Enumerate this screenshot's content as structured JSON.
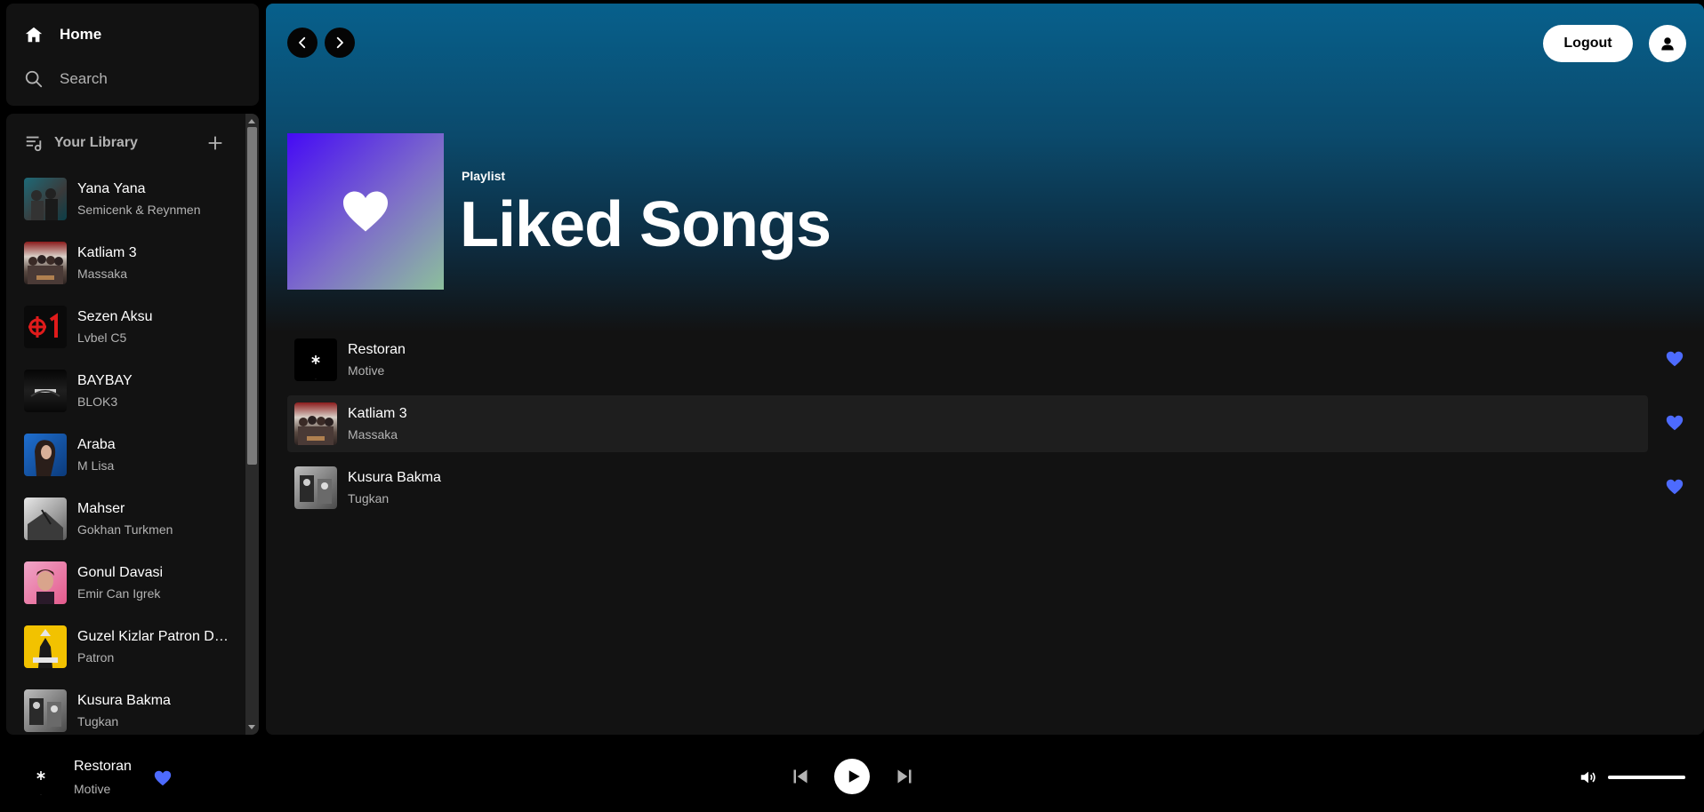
{
  "nav": {
    "home_label": "Home",
    "search_label": "Search"
  },
  "library": {
    "title": "Your Library",
    "items": [
      {
        "title": "Yana Yana",
        "subtitle": "Semicenk & Reynmen",
        "cover": "teal-group-photo"
      },
      {
        "title": "Katliam 3",
        "subtitle": "Massaka",
        "cover": "red-group-photo"
      },
      {
        "title": "Sezen Aksu",
        "subtitle": "Lvbel C5",
        "cover": "red-logo-on-black"
      },
      {
        "title": "BAYBAY",
        "subtitle": "BLOK3",
        "cover": "dark-text-cover"
      },
      {
        "title": "Araba",
        "subtitle": "M Lisa",
        "cover": "blue-portrait"
      },
      {
        "title": "Mahser",
        "subtitle": "Gokhan Turkmen",
        "cover": "grey-photo"
      },
      {
        "title": "Gonul Davasi",
        "subtitle": "Emir Can Igrek",
        "cover": "pink-portrait"
      },
      {
        "title": "Guzel Kizlar Patron Di...",
        "subtitle": "Patron",
        "cover": "yellow-cover"
      },
      {
        "title": "Kusura Bakma",
        "subtitle": "Tugkan",
        "cover": "bw-photo"
      }
    ]
  },
  "header": {
    "logout_label": "Logout"
  },
  "playlist": {
    "type_label": "Playlist",
    "title": "Liked Songs"
  },
  "tracks": [
    {
      "title": "Restoran",
      "artist": "Motive",
      "cover": "black-star"
    },
    {
      "title": "Katliam 3",
      "artist": "Massaka",
      "cover": "red-group-photo"
    },
    {
      "title": "Kusura Bakma",
      "artist": "Tugkan",
      "cover": "bw-photo"
    }
  ],
  "now_playing": {
    "title": "Restoran",
    "artist": "Motive",
    "liked": true
  },
  "volume": {
    "level": 1.0
  },
  "colors": {
    "accent": "#4d6bff",
    "background": "#121212",
    "header_gradient_top": "#07608c"
  }
}
